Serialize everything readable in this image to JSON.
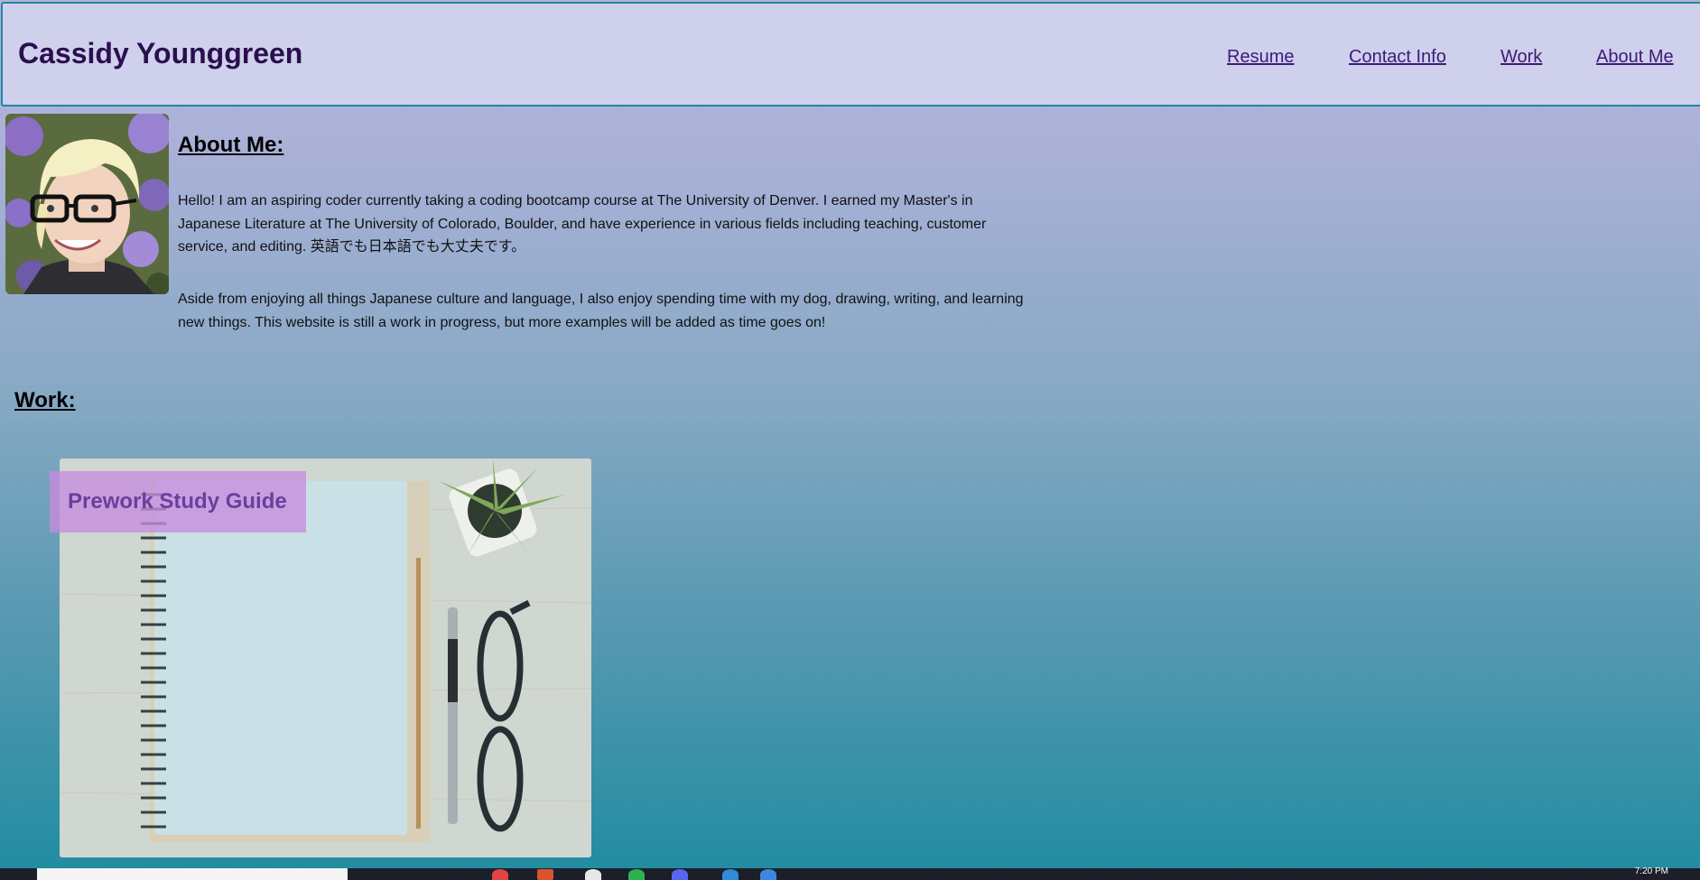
{
  "header": {
    "site_title": "Cassidy Younggreen",
    "nav": {
      "resume": "Resume",
      "contact": "Contact Info",
      "work": "Work",
      "about": "About Me"
    }
  },
  "about": {
    "heading": "About Me:",
    "paragraph1": "Hello! I am an aspiring coder currently taking a coding bootcamp course at The University of Denver. I earned my Master's in Japanese Literature at The University of Colorado, Boulder, and have experience in various fields including teaching, customer service, and editing. 英語でも日本語でも大丈夫です。",
    "paragraph2": "Aside from enjoying all things Japanese culture and language, I also enjoy spending time with my dog, drawing, writing, and learning new things. This website is still a work in progress, but more examples will be added as time goes on!"
  },
  "work": {
    "heading": "Work:",
    "projects": [
      {
        "title": "Prework Study Guide"
      }
    ]
  },
  "taskbar": {
    "clock": "7:20 PM"
  },
  "colors": {
    "header_bg": "#cfd0ec",
    "header_border": "#1e86a4",
    "title_color": "#2a0f4e",
    "nav_link": "#3d1a78",
    "label_bg": "#c68cde",
    "gradient_top": "#bcb4da",
    "gradient_bottom": "#1f8ca0"
  }
}
